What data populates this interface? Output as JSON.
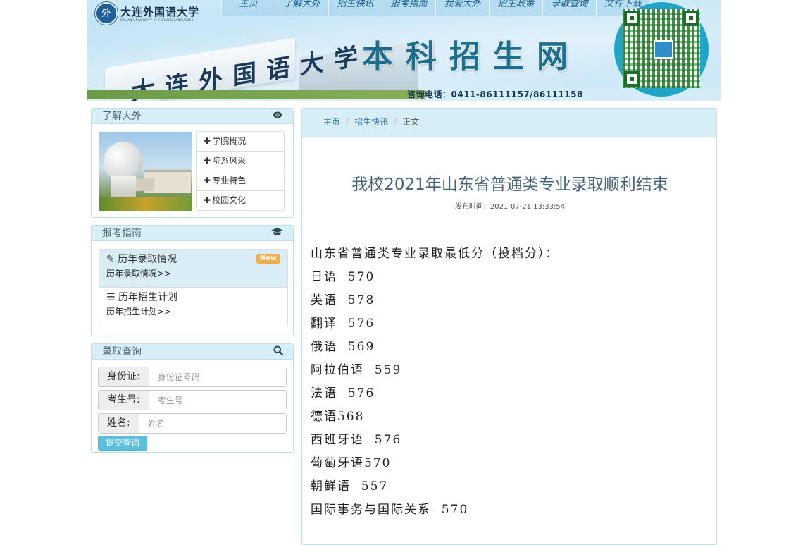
{
  "header": {
    "logo_cn": "大连外国语大学",
    "logo_en": "DALIAN UNIVERSITY OF FOREIGN LANGUAGES",
    "gate_text": "大连外国语大学",
    "site_title": "本科招生网",
    "phone": "咨询电话：0411-86111157/86111158",
    "nav": [
      "主页",
      "了解大外",
      "招生快讯",
      "报考指南",
      "我爱大外",
      "招生政策",
      "录取查询",
      "文件下载"
    ]
  },
  "sidebar": {
    "about": {
      "title": "了解大外",
      "icon": "eye-icon",
      "items": [
        "学院概况",
        "院系风采",
        "专业特色",
        "校园文化"
      ]
    },
    "guide": {
      "title": "报考指南",
      "icon": "graduation-cap-icon",
      "items": [
        {
          "heading": "历年录取情况",
          "sub": "历年录取情况>>",
          "badge": "New",
          "icon": "pencil-icon"
        },
        {
          "heading": "历年招生计划",
          "sub": "历年招生计划>>",
          "badge": "",
          "icon": "list-icon"
        }
      ]
    },
    "query": {
      "title": "录取查询",
      "icon": "search-icon",
      "fields": [
        {
          "label": "身份证:",
          "placeholder": "身份证号码"
        },
        {
          "label": "考生号:",
          "placeholder": "考生号"
        },
        {
          "label": "姓名:",
          "placeholder": "姓名"
        }
      ],
      "submit": "提交查询"
    }
  },
  "main": {
    "breadcrumb": [
      "主页",
      "招生快讯",
      "正文"
    ],
    "title": "我校2021年山东省普通类专业录取顺利结束",
    "meta": "发布时间：2021-07-21 13:33:54",
    "lines": [
      "山东省普通类专业录取最低分（投档分）：",
      "日语  570",
      "英语  578",
      "翻译  576",
      "俄语  569",
      "阿拉伯语  559",
      "法语  576",
      "德语568",
      "西班牙语  576",
      "葡萄牙语570",
      "朝鲜语  557",
      "国际事务与国际关系  570"
    ]
  },
  "colors": {
    "panel_border": "#bde2ee",
    "panel_head": "#d8eef6",
    "title": "#44657c",
    "link": "#337ab7",
    "badge": "#f0ad4e",
    "button": "#5bc0de"
  }
}
